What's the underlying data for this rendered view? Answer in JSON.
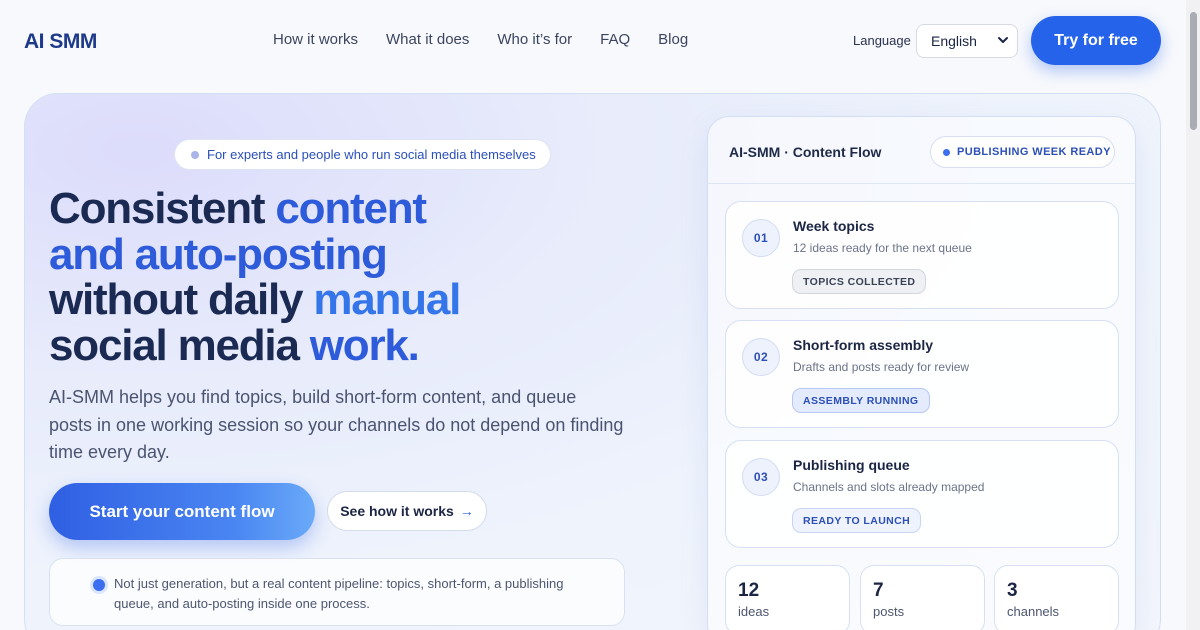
{
  "header": {
    "logo": "AI SMM",
    "nav": [
      "How it works",
      "What it does",
      "Who it’s for",
      "FAQ",
      "Blog"
    ],
    "language_label": "Language",
    "language_value": "English",
    "cta": "Try for free"
  },
  "hero": {
    "badge": "For experts and people who run social media themselves",
    "headline": {
      "line1_a": "Consistent ",
      "line1_b": "content",
      "line2": "and auto-posting",
      "line3_a": "without daily ",
      "line3_b": "manual",
      "line4_a": "social media ",
      "line4_b": "work."
    },
    "subtext": "AI-SMM helps you find topics, build short-form content, and queue posts in one working session so your channels do not depend on finding time every day.",
    "primary_cta": "Start your content flow",
    "secondary_cta": "See how it works",
    "secondary_arrow": "→",
    "note": "Not just generation, but a real content pipeline: topics, short-form, a publishing queue, and auto-posting inside one process."
  },
  "panel": {
    "title": "AI-SMM · Content Flow",
    "status": "PUBLISHING WEEK READY",
    "steps": [
      {
        "num": "01",
        "title": "Week topics",
        "desc": "12 ideas ready for the next queue",
        "tag": "TOPICS COLLECTED"
      },
      {
        "num": "02",
        "title": "Short-form assembly",
        "desc": "Drafts and posts ready for review",
        "tag": "ASSEMBLY RUNNING"
      },
      {
        "num": "03",
        "title": "Publishing queue",
        "desc": "Channels and slots already mapped",
        "tag": "READY TO LAUNCH"
      }
    ],
    "stats": [
      {
        "value": "12",
        "label": "ideas"
      },
      {
        "value": "7",
        "label": "posts"
      },
      {
        "value": "3",
        "label": "channels"
      }
    ]
  },
  "colors": {
    "accent": "#2563eb",
    "headline_dark": "#1b2a52",
    "headline_blue": "#2d5bd9"
  }
}
